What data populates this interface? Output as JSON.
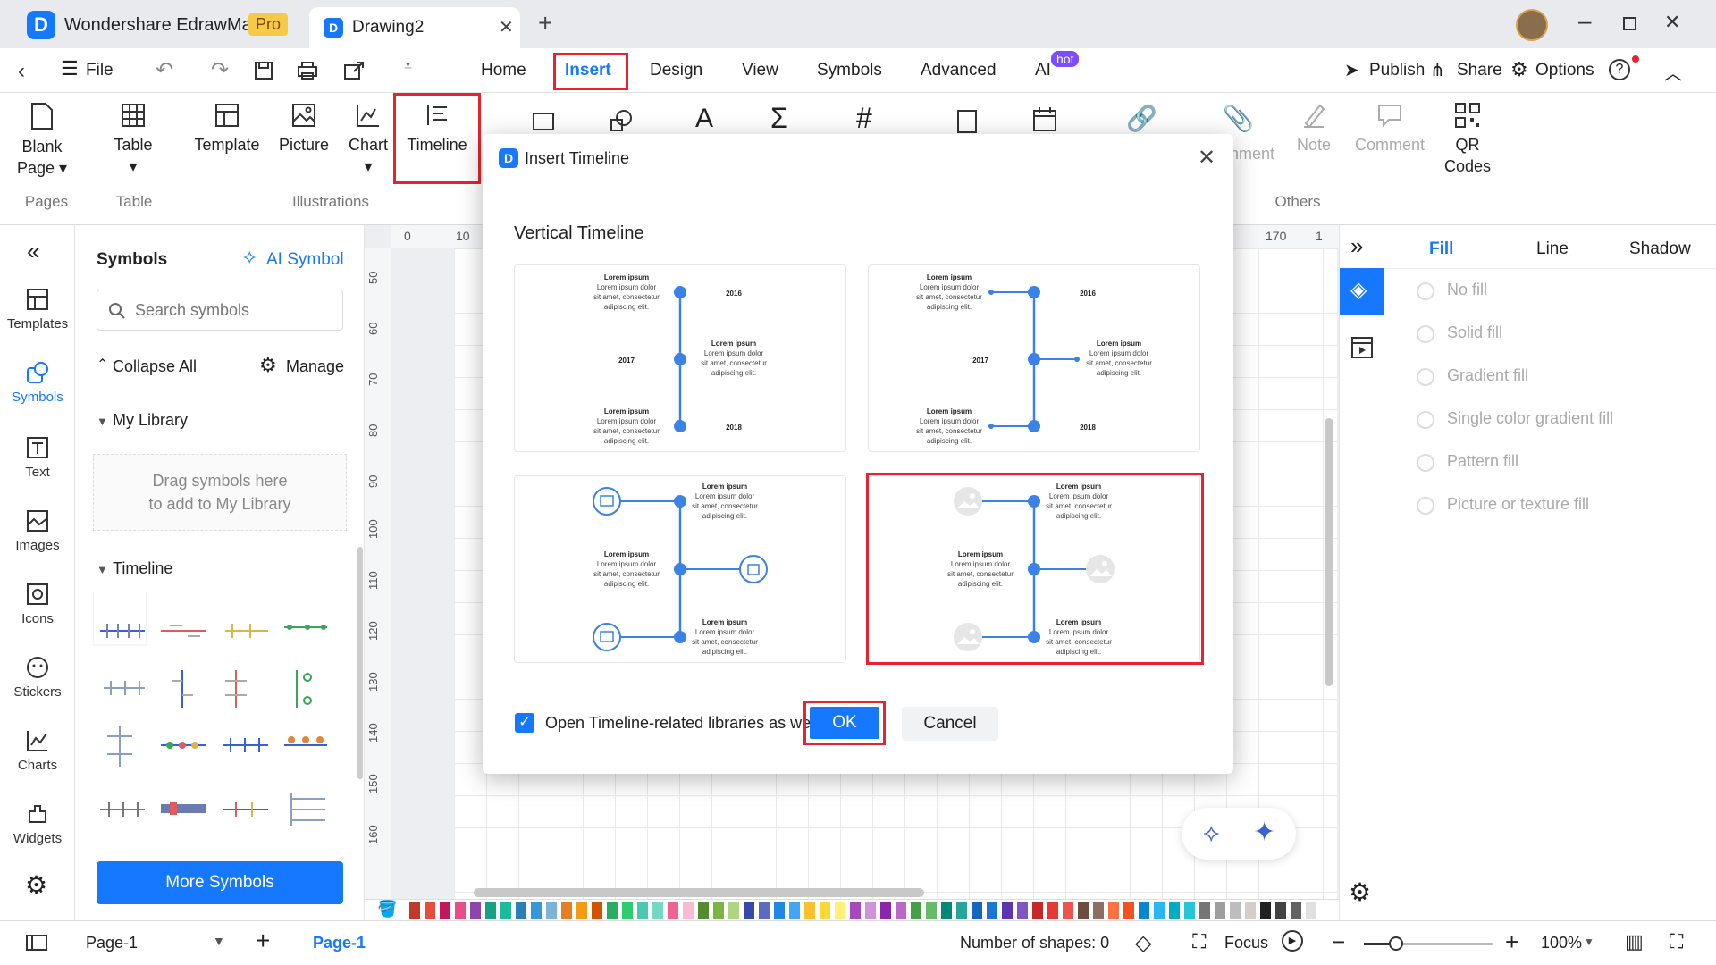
{
  "app": {
    "title": "Wondershare EdrawMax",
    "badge": "Pro",
    "doc_tab": "Drawing2"
  },
  "menu": {
    "file": "File",
    "tabs": [
      "Home",
      "Insert",
      "Design",
      "View",
      "Symbols",
      "Advanced",
      "AI"
    ],
    "ai_badge": "hot",
    "right": {
      "publish": "Publish",
      "share": "Share",
      "options": "Options"
    }
  },
  "ribbon": {
    "blank_page": [
      "Blank",
      "Page"
    ],
    "table": "Table",
    "template": "Template",
    "picture": "Picture",
    "chart": "Chart",
    "timeline": "Timeline",
    "attachment_partial": "nment",
    "note": "Note",
    "comment": "Comment",
    "qr": [
      "QR",
      "Codes"
    ],
    "groups": {
      "pages": "Pages",
      "table": "Table",
      "illustrations": "Illustrations",
      "others": "Others"
    }
  },
  "rail": [
    "Templates",
    "Symbols",
    "Text",
    "Images",
    "Icons",
    "Stickers",
    "Charts",
    "Widgets"
  ],
  "symbols_panel": {
    "title": "Symbols",
    "ai_symbol": "AI Symbol",
    "search_placeholder": "Search symbols",
    "collapse_all": "Collapse All",
    "manage": "Manage",
    "my_library": "My Library",
    "drop_hint_1": "Drag symbols here",
    "drop_hint_2": "to add to My Library",
    "timeline": "Timeline",
    "more_symbols": "More Symbols"
  },
  "ruler": {
    "top": [
      "0",
      "10",
      "170",
      "1"
    ],
    "left": [
      "50",
      "60",
      "70",
      "80",
      "90",
      "100",
      "110",
      "120",
      "130",
      "140",
      "150",
      "160"
    ]
  },
  "right_panel": {
    "tabs": [
      "Fill",
      "Line",
      "Shadow"
    ],
    "options": [
      "No fill",
      "Solid fill",
      "Gradient fill",
      "Single color gradient fill",
      "Pattern fill",
      "Picture or texture fill"
    ]
  },
  "dialog": {
    "title": "Insert Timeline",
    "section": "Vertical Timeline",
    "checkbox_label": "Open Timeline-related libraries as well",
    "ok": "OK",
    "cancel": "Cancel",
    "card_text": {
      "heading": "Lorem ipsum",
      "line1": "Lorem ipsum dolor",
      "line2": "sit amet, consectetur",
      "line3": "adipiscing elit.",
      "years": [
        "2016",
        "2017",
        "2018"
      ]
    }
  },
  "status": {
    "page_select": "Page-1",
    "page_tab": "Page-1",
    "shapes": "Number of shapes: 0",
    "focus": "Focus",
    "zoom": "100%"
  },
  "colors": {
    "accent": "#1677ff",
    "highlight": "#e8222e",
    "timeline_blue": "#3b82e6"
  }
}
